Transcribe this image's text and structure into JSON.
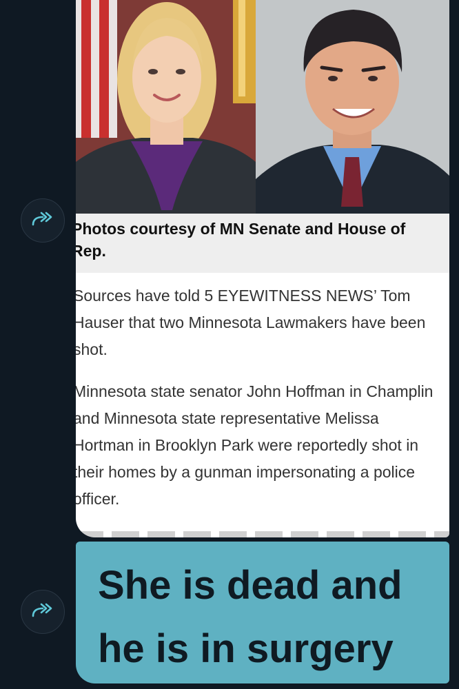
{
  "icons": {
    "forward": "forward-arrow-icon"
  },
  "colors": {
    "background": "#0f1923",
    "bubble": "#5fb1c2",
    "card": "#ffffff",
    "caption_bg": "#eeeeee"
  },
  "article": {
    "caption": "Photos courtesy of MN Senate and House of Rep.",
    "paragraphs": [
      "Sources have told 5 EYEWITNESS NEWS’ Tom Hauser that two Minnesota Lawmakers have been shot.",
      "Minnesota state senator John Hoffman in Champlin and Minnesota state representative Melissa Hortman in Brooklyn Park were reportedly shot in their homes by a gunman impersonating a police officer."
    ]
  },
  "reply": {
    "text": "She is dead and he is in surgery"
  }
}
